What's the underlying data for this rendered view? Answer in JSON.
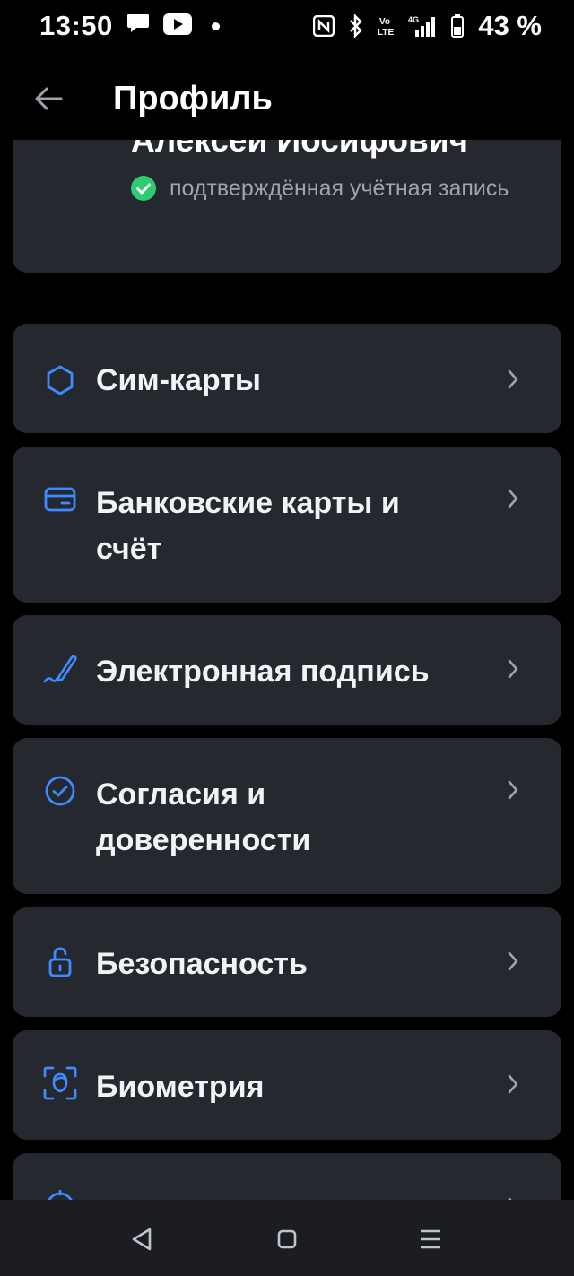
{
  "status_bar": {
    "time": "13:50",
    "battery": "43 %",
    "icons": [
      "chat-icon",
      "youtube-icon",
      "nfc-icon",
      "bluetooth-icon",
      "volte-icon",
      "4g-signal-icon",
      "battery-icon"
    ]
  },
  "app_bar": {
    "title": "Профиль",
    "back_icon": "arrow-left-icon"
  },
  "profile": {
    "name": "Алексей Иосифович",
    "verified_text": "подтверждённая учётная запись",
    "verified_icon": "check-circle-icon",
    "verified_color": "#2ecc71"
  },
  "menu": {
    "items": [
      {
        "label": "Сим-карты",
        "icon": "sim-card-icon"
      },
      {
        "label": "Банковские карты и счёт",
        "icon": "bank-card-icon"
      },
      {
        "label": "Электронная подпись",
        "icon": "signature-pen-icon"
      },
      {
        "label": "Согласия и доверенности",
        "icon": "check-circle-outline-icon"
      },
      {
        "label": "Безопасность",
        "icon": "unlocked-padlock-icon"
      },
      {
        "label": "Биометрия",
        "icon": "face-scan-icon"
      },
      {
        "label": "",
        "icon": "partial-icon"
      }
    ],
    "chevron_icon": "chevron-right-icon"
  },
  "colors": {
    "accent": "#3d8bff",
    "card_bg": "#262830",
    "background": "#000000",
    "secondary_text": "#9ea3ad",
    "chevron": "#9ea3ad"
  },
  "nav_bar": {
    "icons": [
      "back-triangle-icon",
      "home-square-icon",
      "menu-lines-icon"
    ]
  }
}
